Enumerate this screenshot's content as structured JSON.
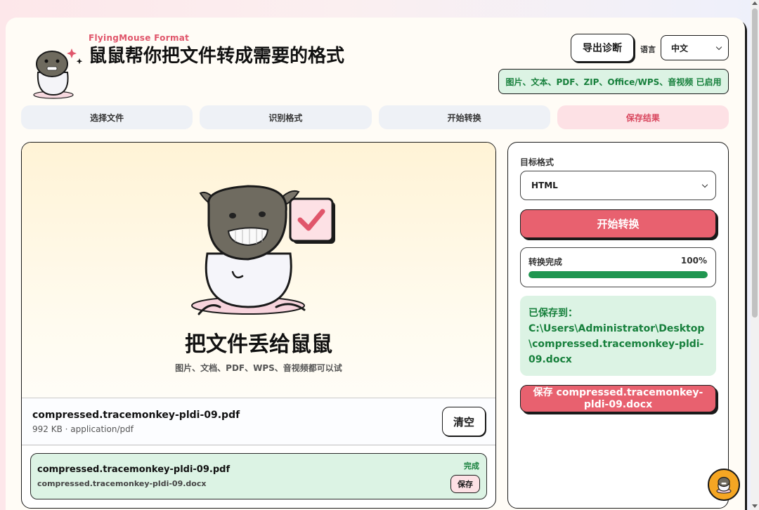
{
  "header": {
    "brand": "FlyingMouse Format",
    "title": "鼠鼠帮你把文件转成需要的格式",
    "export_label": "导出诊断",
    "lang_label": "语言",
    "lang_value": "中文",
    "formats_badge": "图片、文本、PDF、ZIP、Office/WPS、音视频 已启用"
  },
  "steps": [
    {
      "label": "选择文件"
    },
    {
      "label": "识别格式"
    },
    {
      "label": "开始转换"
    },
    {
      "label": "保存结果"
    }
  ],
  "drop": {
    "title": "把文件丢给鼠鼠",
    "subtitle": "图片、文档、PDF、WPS、音视频都可以试"
  },
  "file": {
    "name": "compressed.tracemonkey-pldi-09.pdf",
    "meta": "992 KB · application/pdf",
    "clear_label": "清空"
  },
  "result": {
    "name": "compressed.tracemonkey-pldi-09.pdf",
    "output": "compressed.tracemonkey-pldi-09.docx",
    "status": "完成",
    "save_label": "保存"
  },
  "side": {
    "target_label": "目标格式",
    "target_value": "HTML",
    "convert_label": "开始转换",
    "progress_label": "转换完成",
    "progress_text": "100%",
    "progress_value": 100,
    "saved_label": "已保存到：",
    "saved_path": "C:\\Users\\Administrator\\Desktop\\compressed.tracemonkey-pldi-09.docx",
    "save_button": "保存 compressed.tracemonkey-pldi-09.docx"
  },
  "colors": {
    "accent": "#e8616f",
    "success": "#17803c",
    "success_bg": "#dcf3e4"
  }
}
